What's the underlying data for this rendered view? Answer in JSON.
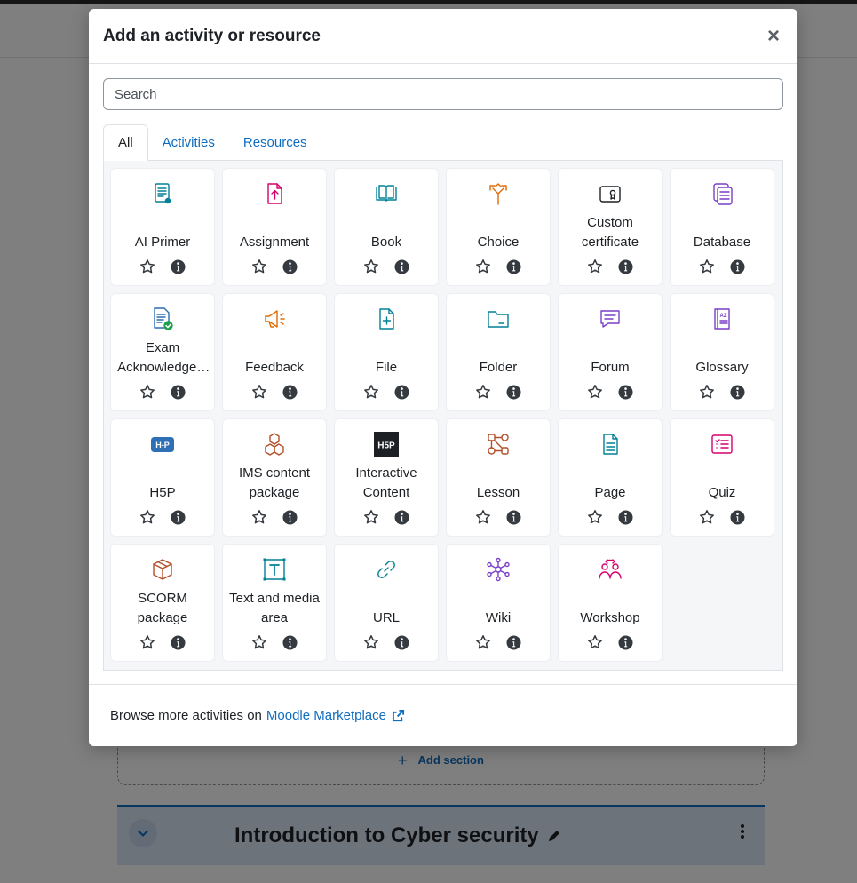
{
  "background": {
    "add_section_label": "Add section",
    "course_section_title": "Introduction to Cyber security"
  },
  "modal": {
    "title": "Add an activity or resource",
    "close_glyph": "×",
    "search": {
      "placeholder": "Search",
      "value": ""
    },
    "tabs": [
      {
        "label": "All",
        "active": true
      },
      {
        "label": "Activities",
        "active": false
      },
      {
        "label": "Resources",
        "active": false
      }
    ],
    "items": [
      {
        "label": "AI Primer",
        "icon": "ai-primer-icon",
        "color": "#008196"
      },
      {
        "label": "Assignment",
        "icon": "assignment-icon",
        "color": "#d6006c"
      },
      {
        "label": "Book",
        "icon": "book-icon",
        "color": "#008196"
      },
      {
        "label": "Choice",
        "icon": "choice-icon",
        "color": "#e26a00"
      },
      {
        "label": "Custom certificate",
        "icon": "certificate-icon",
        "color": "#1d2125"
      },
      {
        "label": "Database",
        "icon": "database-icon",
        "color": "#7a3fc7"
      },
      {
        "label": "Exam Acknowledgement",
        "icon": "exam-acknowledgement-icon",
        "color": "#2b6cb0"
      },
      {
        "label": "Feedback",
        "icon": "feedback-icon",
        "color": "#e26a00"
      },
      {
        "label": "File",
        "icon": "file-icon",
        "color": "#008196"
      },
      {
        "label": "Folder",
        "icon": "folder-icon",
        "color": "#008196"
      },
      {
        "label": "Forum",
        "icon": "forum-icon",
        "color": "#7a3fc7"
      },
      {
        "label": "Glossary",
        "icon": "glossary-icon",
        "color": "#7a3fc7"
      },
      {
        "label": "H5P",
        "icon": "h5p-icon",
        "color": "#2f6fb6"
      },
      {
        "label": "IMS content package",
        "icon": "ims-package-icon",
        "color": "#b2502a"
      },
      {
        "label": "Interactive Content",
        "icon": "interactive-content-icon",
        "color": "#1d2125"
      },
      {
        "label": "Lesson",
        "icon": "lesson-icon",
        "color": "#b2502a"
      },
      {
        "label": "Page",
        "icon": "page-icon",
        "color": "#008196"
      },
      {
        "label": "Quiz",
        "icon": "quiz-icon",
        "color": "#d6006c"
      },
      {
        "label": "SCORM package",
        "icon": "scorm-icon",
        "color": "#b2502a"
      },
      {
        "label": "Text and media area",
        "icon": "text-media-icon",
        "color": "#008196"
      },
      {
        "label": "URL",
        "icon": "url-icon",
        "color": "#008196"
      },
      {
        "label": "Wiki",
        "icon": "wiki-icon",
        "color": "#7a3fc7"
      },
      {
        "label": "Workshop",
        "icon": "workshop-icon",
        "color": "#d6006c"
      }
    ],
    "footer": {
      "text": "Browse more activities on",
      "link_label": "Moodle Marketplace"
    }
  }
}
